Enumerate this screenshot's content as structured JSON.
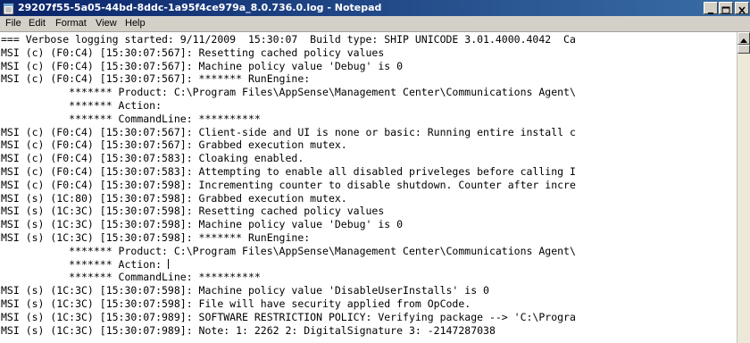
{
  "window": {
    "title": "29207f55-5a05-44bd-8ddc-1a95f4ce979a_8.0.736.0.log - Notepad",
    "icon": "notepad-icon",
    "accent_color": "#0a246a"
  },
  "menu": [
    {
      "label": "File",
      "icon": ""
    },
    {
      "label": "Edit",
      "icon": ""
    },
    {
      "label": "Format",
      "icon": ""
    },
    {
      "label": "View",
      "icon": ""
    },
    {
      "label": "Help",
      "icon": ""
    }
  ],
  "log_lines": [
    "=== Verbose logging started: 9/11/2009  15:30:07  Build type: SHIP UNICODE 3.01.4000.4042  Ca",
    "MSI (c) (F0:C4) [15:30:07:567]: Resetting cached policy values",
    "MSI (c) (F0:C4) [15:30:07:567]: Machine policy value 'Debug' is 0",
    "MSI (c) (F0:C4) [15:30:07:567]: ******* RunEngine:",
    "           ******* Product: C:\\Program Files\\AppSense\\Management Center\\Communications Agent\\",
    "           ******* Action:",
    "           ******* CommandLine: **********",
    "MSI (c) (F0:C4) [15:30:07:567]: Client-side and UI is none or basic: Running entire install c",
    "MSI (c) (F0:C4) [15:30:07:567]: Grabbed execution mutex.",
    "MSI (c) (F0:C4) [15:30:07:583]: Cloaking enabled.",
    "MSI (c) (F0:C4) [15:30:07:583]: Attempting to enable all disabled priveleges before calling I",
    "MSI (c) (F0:C4) [15:30:07:598]: Incrementing counter to disable shutdown. Counter after incre",
    "MSI (s) (1C:80) [15:30:07:598]: Grabbed execution mutex.",
    "MSI (s) (1C:3C) [15:30:07:598]: Resetting cached policy values",
    "MSI (s) (1C:3C) [15:30:07:598]: Machine policy value 'Debug' is 0",
    "MSI (s) (1C:3C) [15:30:07:598]: ******* RunEngine:",
    "           ******* Product: C:\\Program Files\\AppSense\\Management Center\\Communications Agent\\",
    "           ******* Action: ",
    "           ******* CommandLine: **********",
    "MSI (s) (1C:3C) [15:30:07:598]: Machine policy value 'DisableUserInstalls' is 0",
    "MSI (s) (1C:3C) [15:30:07:598]: File will have security applied from OpCode.",
    "MSI (s) (1C:3C) [15:30:07:989]: SOFTWARE RESTRICTION POLICY: Verifying package --> 'C:\\Progra",
    "MSI (s) (1C:3C) [15:30:07:989]: Note: 1: 2262 2: DigitalSignature 3: -2147287038"
  ]
}
